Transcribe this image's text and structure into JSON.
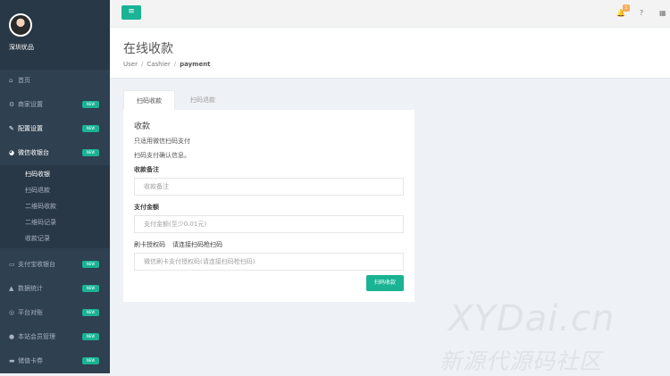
{
  "profile": {
    "name": "深圳优品"
  },
  "nav": {
    "items": [
      {
        "icon": "home-icon",
        "glyph": "⌂",
        "label": "首页",
        "badge": ""
      },
      {
        "icon": "cogs-icon",
        "glyph": "⚙",
        "label": "商家设置",
        "badge": "NEW"
      },
      {
        "icon": "wrench-icon",
        "glyph": "✎",
        "label": "配置设置",
        "badge": "NEW"
      },
      {
        "icon": "wechat-icon",
        "glyph": "◕",
        "label": "微信收银台",
        "badge": "NEW"
      },
      {
        "icon": "laptop-icon",
        "glyph": "▭",
        "label": "支付宝收银台",
        "badge": "NEW"
      },
      {
        "icon": "chart-icon",
        "glyph": "▲",
        "label": "数据统计",
        "badge": "NEW"
      },
      {
        "icon": "globe-icon",
        "glyph": "◎",
        "label": "平台对账",
        "badge": "NEW"
      },
      {
        "icon": "user-icon",
        "glyph": "●",
        "label": "本站会员管理",
        "badge": "NEW"
      },
      {
        "icon": "card-icon",
        "glyph": "▬",
        "label": "储值卡券",
        "badge": "NEW"
      }
    ],
    "sub": [
      "扫码收银",
      "扫码退款",
      "二维码收款",
      "二维码记录",
      "收款记录"
    ]
  },
  "topbar": {
    "menu_glyph": "≡",
    "notify_count": "1"
  },
  "header": {
    "title": "在线收款",
    "crumbs": [
      "User",
      "Cashier",
      "payment"
    ]
  },
  "tabs": [
    "扫码收款",
    "扫码退款"
  ],
  "form": {
    "section_title": "收款",
    "desc1": "只适用微信扫码支付",
    "desc2": "扫码支付确认信息。",
    "remark_label": "收款备注",
    "remark_placeholder": "收款备注",
    "amount_label": "支付金额",
    "amount_placeholder": "支付金额(至少0.01元)",
    "authcode_label": "刷卡授权码",
    "authcode_hint": "请连接扫码枪扫码",
    "authcode_placeholder": "微信刷卡支付授权码(请连接扫码枪扫码)",
    "submit_label": "扫码收款"
  },
  "watermark": {
    "line1": "XYDai.cn",
    "line2": "新源代源码社区"
  },
  "colors": {
    "sidebar": "#2f4050",
    "accent": "#1ab394",
    "notify": "#f8ac59"
  }
}
